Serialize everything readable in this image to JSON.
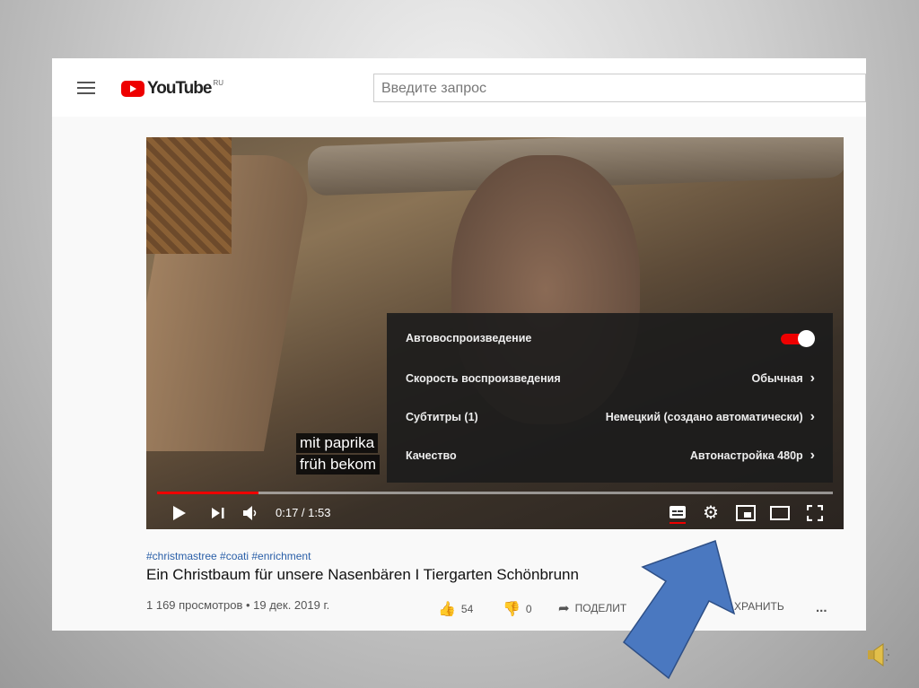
{
  "header": {
    "logo_text": "YouTube",
    "logo_region": "RU",
    "search_placeholder": "Введите запрос"
  },
  "video": {
    "subtitles": [
      "mit paprika",
      "früh bekom"
    ],
    "settings": [
      {
        "label": "Автовоспроизведение",
        "toggle_on": true
      },
      {
        "label": "Скорость воспроизведения",
        "value": "Обычная"
      },
      {
        "label": "Субтитры (1)",
        "value": "Немецкий (создано автоматически)"
      },
      {
        "label": "Качество",
        "value": "Автонастройка 480p"
      }
    ],
    "time": "0:17 / 1:53",
    "progress_percent": 15,
    "accent": "#ee0000"
  },
  "info": {
    "tags": "#christmastree #coati #enrichment",
    "title": "Ein Christbaum für unsere Nasenbären I Tiergarten Schönbrunn",
    "views": "1 169 просмотров • 19 дек. 2019 г.",
    "likes": "54",
    "dislikes": "0",
    "share": "ПОДЕЛИТ",
    "save": "ХРАНИТЬ",
    "more": "..."
  }
}
